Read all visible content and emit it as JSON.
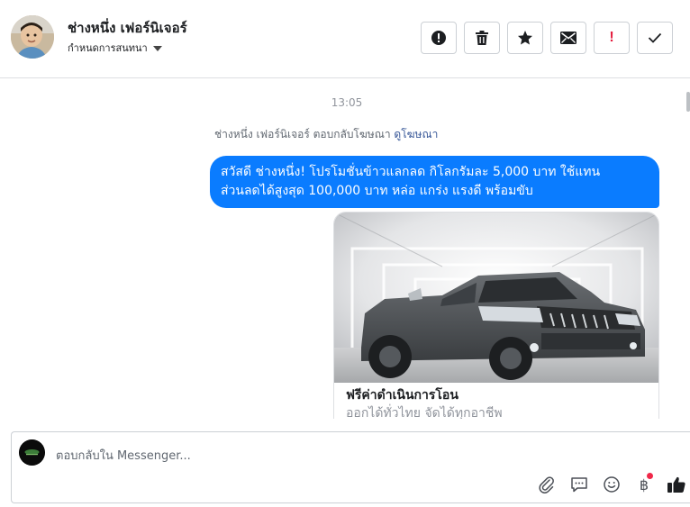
{
  "header": {
    "contact_name": "ช่างหนึ่ง เฟอร์นิเจอร์",
    "assign_label": "กำหนดการสนทนา",
    "actions": [
      {
        "name": "report-spam",
        "icon": "exclamation-circle-icon"
      },
      {
        "name": "delete",
        "icon": "trash-icon"
      },
      {
        "name": "star",
        "icon": "star-icon"
      },
      {
        "name": "mark-unread",
        "icon": "envelope-icon"
      },
      {
        "name": "mark-important",
        "icon": "exclamation-mark-icon"
      },
      {
        "name": "mark-done",
        "icon": "checkmark-icon"
      }
    ]
  },
  "conversation": {
    "timestamp": "13:05",
    "notice_text": "ช่างหนึ่ง เฟอร์นิเจอร์ ตอบกลับโฆษณา",
    "notice_link": "ดูโฆษณา",
    "message_line1": "สวัสดี ช่างหนึ่ง! โปรโมชั่นข้าวแลกลด กิโลกรัมละ 5,000 บาท ใช้แทน",
    "message_line2": "ส่วนลดได้สูงสุด 100,000 บาท หล่อ แกร่ง แรงดี พร้อมขับ",
    "ad_card": {
      "title": "ฟรีค่าดำเนินการโอน",
      "subtitle": "ออกได้ทั่วไทย จัดได้ทุกอาชีพ",
      "image": "gray-pickup-truck-photo"
    }
  },
  "composer": {
    "placeholder": "ตอบกลับใน Messenger...",
    "tools": [
      "paperclip-icon",
      "saved-replies-icon",
      "emoji-icon",
      "payment-baht-icon",
      "thumbs-up-icon"
    ],
    "baht_symbol": "฿"
  },
  "colors": {
    "accent": "#0a7cff",
    "link": "#385898",
    "alert": "#e41e3f",
    "notification_dot": "#f02849"
  }
}
